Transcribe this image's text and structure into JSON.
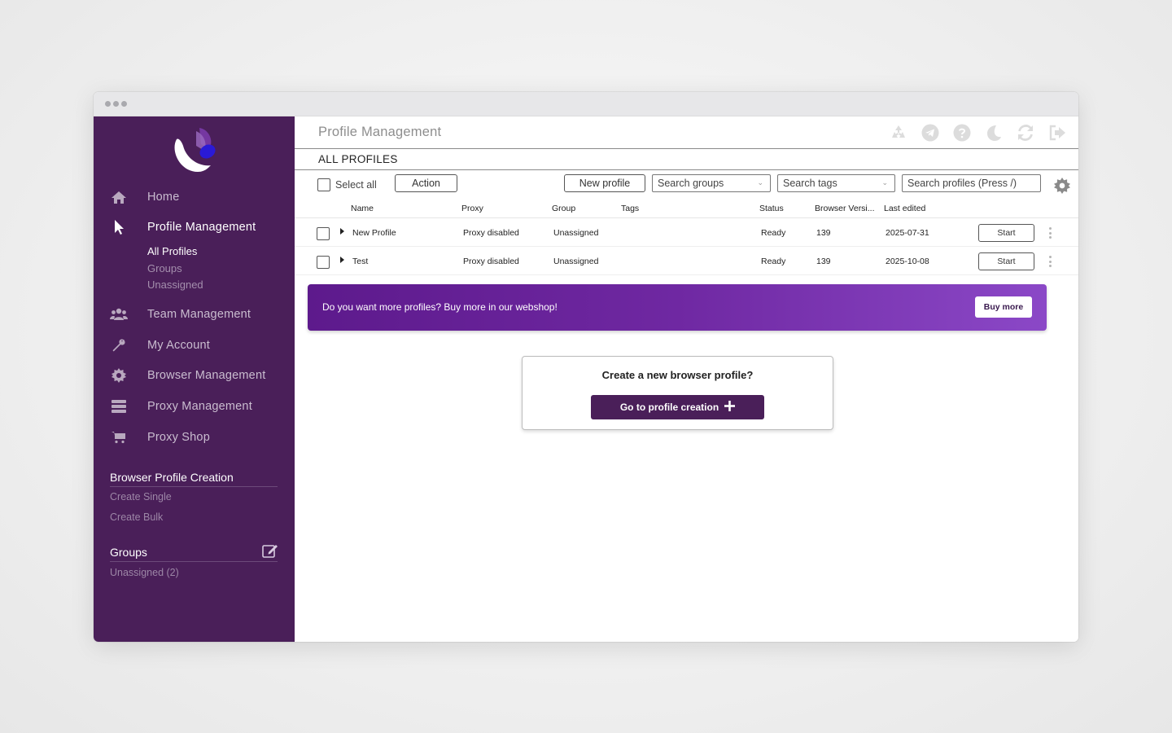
{
  "page": {
    "title": "Profile Management",
    "section": "ALL PROFILES"
  },
  "sidebar": {
    "nav": [
      {
        "label": "Home",
        "icon": "home-icon"
      },
      {
        "label": "Profile Management",
        "icon": "cursor-icon",
        "active": true
      },
      {
        "label": "Team Management",
        "icon": "users-icon"
      },
      {
        "label": "My Account",
        "icon": "wrench-icon"
      },
      {
        "label": "Browser Management",
        "icon": "gear-icon"
      },
      {
        "label": "Proxy Management",
        "icon": "server-icon"
      },
      {
        "label": "Proxy Shop",
        "icon": "cart-icon"
      }
    ],
    "profile_sub": [
      "All Profiles",
      "Groups",
      "Unassigned"
    ],
    "creation": {
      "title": "Browser Profile Creation",
      "links": [
        "Create Single",
        "Create Bulk"
      ]
    },
    "groups": {
      "title": "Groups",
      "items": [
        "Unassigned (2)"
      ]
    }
  },
  "toolbar": {
    "select_all": "Select all",
    "action": "Action",
    "new_profile": "New profile",
    "search_groups": "Search groups",
    "search_tags": "Search tags",
    "search_profiles": "Search profiles (Press /)"
  },
  "table": {
    "columns": [
      "Name",
      "Proxy",
      "Group",
      "Tags",
      "Status",
      "Browser Versi...",
      "Last edited"
    ],
    "rows": [
      {
        "name": "New Profile",
        "proxy": "Proxy disabled",
        "group": "Unassigned",
        "tags": "",
        "status": "Ready",
        "version": "139",
        "edited": "2025-07-31",
        "start": "Start"
      },
      {
        "name": "Test",
        "proxy": "Proxy disabled",
        "group": "Unassigned",
        "tags": "",
        "status": "Ready",
        "version": "139",
        "edited": "2025-10-08",
        "start": "Start"
      }
    ]
  },
  "promo": {
    "text": "Do you want more profiles? Buy more in our webshop!",
    "button": "Buy more"
  },
  "create": {
    "question": "Create a new browser profile?",
    "button": "Go to profile creation"
  },
  "colors": {
    "sidebar": "#4a1f59",
    "accent": "#6f28a2",
    "button_dark": "#4a1f59"
  }
}
